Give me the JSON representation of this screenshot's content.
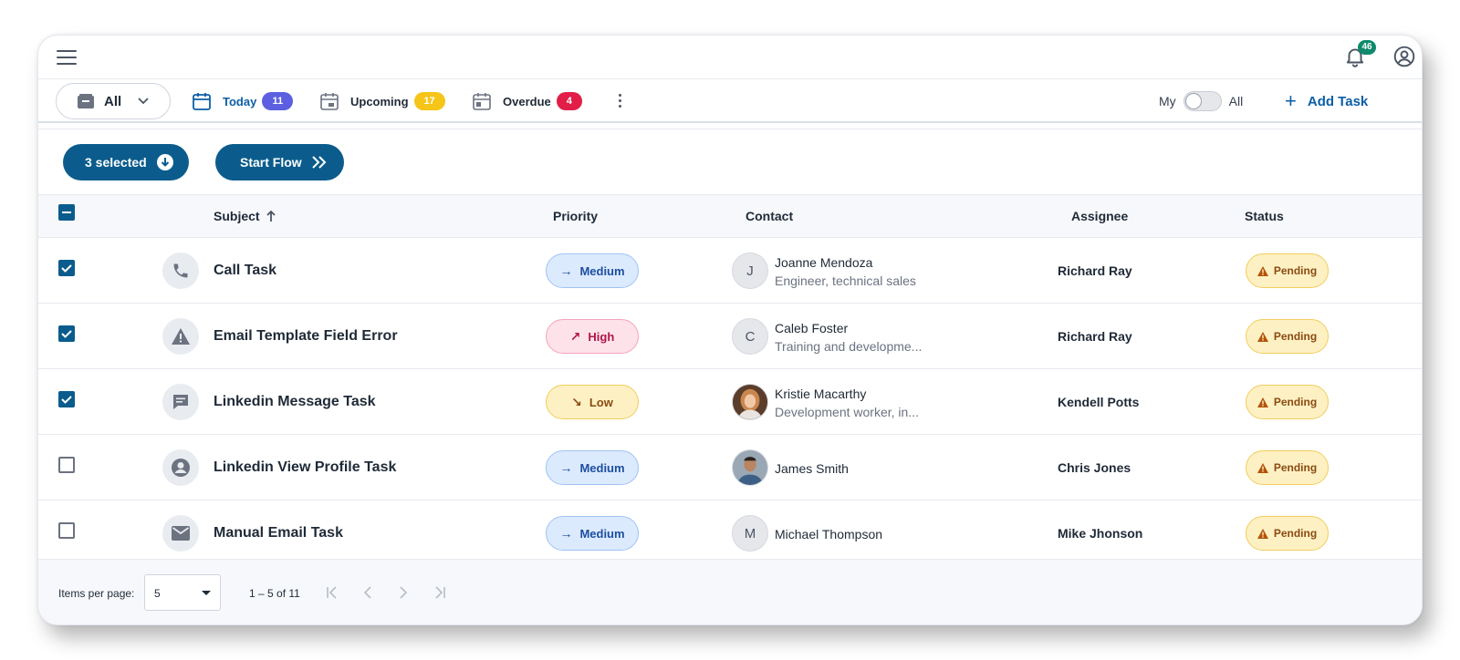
{
  "topbar": {
    "notifications_count": "46"
  },
  "filters": {
    "view_select": "All",
    "tabs": [
      {
        "label": "Today",
        "count": "11",
        "badge_color": "#5b5fe0",
        "label_color": "#0b5fa5"
      },
      {
        "label": "Upcoming",
        "count": "17",
        "badge_color": "#f5c518",
        "label_color": "#1f2a37"
      },
      {
        "label": "Overdue",
        "count": "4",
        "badge_color": "#e11d48",
        "label_color": "#1f2a37"
      }
    ],
    "toggle_left": "My",
    "toggle_right": "All",
    "add_task": "Add Task"
  },
  "actions": {
    "selected": "3 selected",
    "start_flow": "Start Flow"
  },
  "table": {
    "columns": {
      "subject": "Subject",
      "priority": "Priority",
      "contact": "Contact",
      "assignee": "Assignee",
      "status": "Status"
    },
    "rows": [
      {
        "checked": true,
        "type_icon": "phone-icon",
        "subject": "Call Task",
        "priority": "Medium",
        "contact_initial": "J",
        "contact_name": "Joanne Mendoza",
        "contact_title": "Engineer, technical sales",
        "assignee": "Richard Ray",
        "status": "Pending"
      },
      {
        "checked": true,
        "type_icon": "warning-icon",
        "subject": "Email Template Field Error",
        "priority": "High",
        "contact_initial": "C",
        "contact_name": "Caleb Foster",
        "contact_title": "Training and developme...",
        "assignee": "Richard Ray",
        "status": "Pending"
      },
      {
        "checked": true,
        "type_icon": "message-icon",
        "subject": "Linkedin Message Task",
        "priority": "Low",
        "contact_initial": "",
        "contact_name": "Kristie Macarthy",
        "contact_title": "Development worker, in...",
        "assignee": "Kendell Potts",
        "status": "Pending"
      },
      {
        "checked": false,
        "type_icon": "profile-icon",
        "subject": "Linkedin View Profile Task",
        "priority": "Medium",
        "contact_initial": "",
        "contact_name": "James Smith",
        "contact_title": "",
        "assignee": "Chris Jones",
        "status": "Pending"
      },
      {
        "checked": false,
        "type_icon": "mail-icon",
        "subject": "Manual Email Task",
        "priority": "Medium",
        "contact_initial": "M",
        "contact_name": "Michael Thompson",
        "contact_title": "",
        "assignee": "Mike Jhonson",
        "status": "Pending"
      }
    ]
  },
  "pagination": {
    "items_per_page_label": "Items per page:",
    "items_per_page": "5",
    "range": "1 – 5 of 11"
  },
  "colors": {
    "primary": "#0b5c8c",
    "medium_bg": "#dceafd",
    "high_bg": "#fde2ea",
    "low_bg": "#fdf1c4",
    "pending_bg": "#fdf1c4"
  }
}
